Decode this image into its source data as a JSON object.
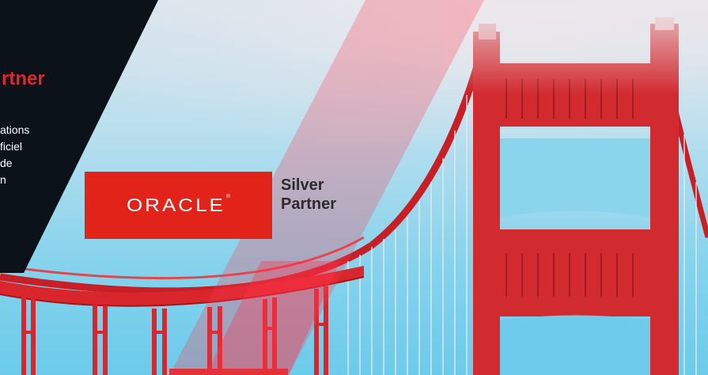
{
  "panel": {
    "title": "rtner",
    "lines": [
      "ations",
      "ficiel",
      "de",
      "n"
    ]
  },
  "logo": {
    "brand": "ORACLE",
    "trademark": "®",
    "level_line1": "Silver",
    "level_line2": "Partner"
  },
  "colors": {
    "oracle_red": "#e2231a",
    "bridge_red": "#d8262c",
    "panel_dark": "#0b121a",
    "sky": "#7fd0ea"
  }
}
